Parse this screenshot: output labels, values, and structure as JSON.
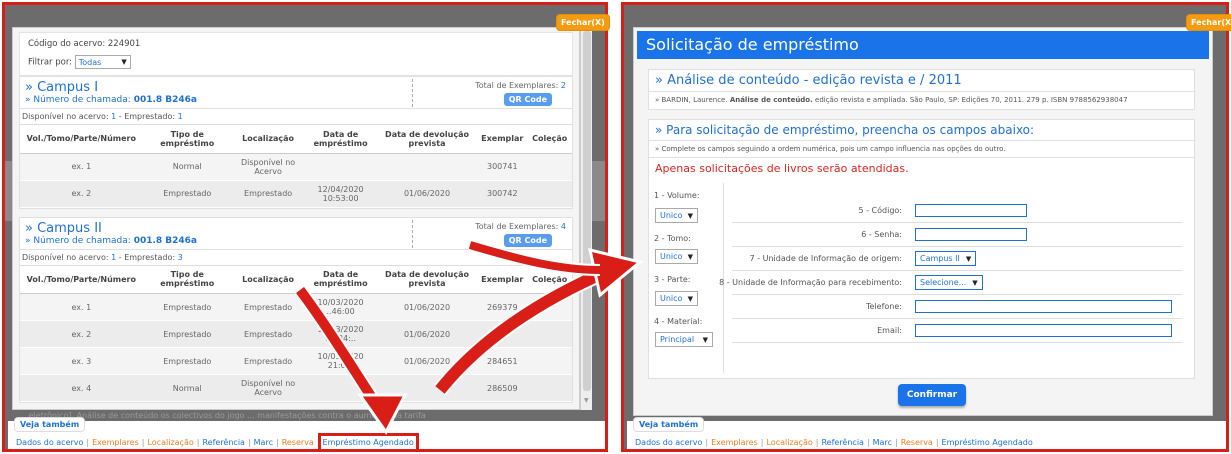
{
  "left": {
    "close_label": "Fechar(X)",
    "codigo": "Código do acervo: 224901",
    "filtrar_label": "Filtrar por:",
    "filtrar_value": "Todas",
    "table_headers": [
      "Vol./Tomo/Parte/Número",
      "Tipo de empréstimo",
      "Localização",
      "Data de empréstimo",
      "Data de devolução prevista",
      "Exemplar",
      "Coleção"
    ],
    "campuses": [
      {
        "name": "» Campus I",
        "callno_label": "» Número de chamada:",
        "callno_value": "001.8 B246a",
        "total_label": "Total de Exemplares:",
        "total_value": "2",
        "qr_label": "QR Code",
        "disp_label": "Disponível no acervo:",
        "disp_value": "1",
        "emp_label": " - Emprestado:",
        "emp_value": "1",
        "rows": [
          [
            "ex. 1",
            "Normal",
            "Disponível no Acervo",
            "",
            "",
            "300741",
            ""
          ],
          [
            "ex. 2",
            "Emprestado",
            "Emprestado",
            "12/04/2020 10:53:00",
            "01/06/2020",
            "300742",
            ""
          ]
        ]
      },
      {
        "name": "» Campus II",
        "callno_label": "» Número de chamada:",
        "callno_value": "001.8 B246a",
        "total_label": "Total de Exemplares:",
        "total_value": "4",
        "qr_label": "QR Code",
        "disp_label": "Disponível no acervo:",
        "disp_value": "1",
        "emp_label": " - Emprestado:",
        "emp_value": "3",
        "rows": [
          [
            "ex. 1",
            "Emprestado",
            "Emprestado",
            "10/03/2020 ..46:00",
            "01/06/2020",
            "269379",
            ""
          ],
          [
            "ex. 2",
            "Emprestado",
            "Emprestado",
            "13/03/2020 19:34:..",
            "01/06/2020",
            "...",
            ""
          ],
          [
            "ex. 3",
            "Emprestado",
            "Emprestado",
            "10/03/2020 21:0...",
            "01/06/2020",
            "284651",
            ""
          ],
          [
            "ex. 4",
            "Normal",
            "Disponível no Acervo",
            "",
            "",
            "286509",
            ""
          ]
        ]
      }
    ],
    "veja_tab": "Veja também",
    "links": [
      "Dados do acervo",
      "Exemplares",
      "Localização",
      "Referência",
      "Marc",
      "Reserva",
      "Empréstimo Agendado"
    ],
    "bg_text": "...eletrônico]. Análise de conteúdo os colectivos do jogo ... manifestações contra o aumento da tarifa"
  },
  "right": {
    "close_label": "Fechar(X)",
    "title": "Solicitação de empréstimo",
    "book_title": "» Análise de conteúdo - edição revista e / 2011",
    "ref_author": "» BARDIN, Laurence.",
    "ref_title": "Análise de conteúdo.",
    "ref_rest": "edição revista e ampliada. São Paulo, SP: Edições 70, 2011. 279 p. ISBN 9788562938047",
    "req_title": "» Para solicitação de empréstimo, preencha os campos abaixo:",
    "req_note": "» Complete os campos seguindo a ordem numérica, pois um campo influencia nas opções do outro.",
    "warning": "Apenas solicitações de livros serão atendidas.",
    "left_fields": [
      {
        "label": "1 - Volume:",
        "value": "Unico"
      },
      {
        "label": "2 - Tomo:",
        "value": "Unico"
      },
      {
        "label": "3 - Parte:",
        "value": "Unico"
      },
      {
        "label": "4 - Material:",
        "value": "Principal"
      }
    ],
    "codigo_label": "5 - Código:",
    "senha_label": "6 - Senha:",
    "origem_label": "7 - Unidade de Informação de origem:",
    "origem_value": "Campus II",
    "receb_label": "8 - Unidade de Informação para recebimento:",
    "receb_value": "Selecione...",
    "telefone_label": "Telefone:",
    "email_label": "Email:",
    "confirm_label": "Confirmar",
    "veja_tab": "Veja também",
    "links": [
      "Dados do acervo",
      "Exemplares",
      "Localização",
      "Referência",
      "Marc",
      "Reserva",
      "Empréstimo Agendado"
    ]
  }
}
